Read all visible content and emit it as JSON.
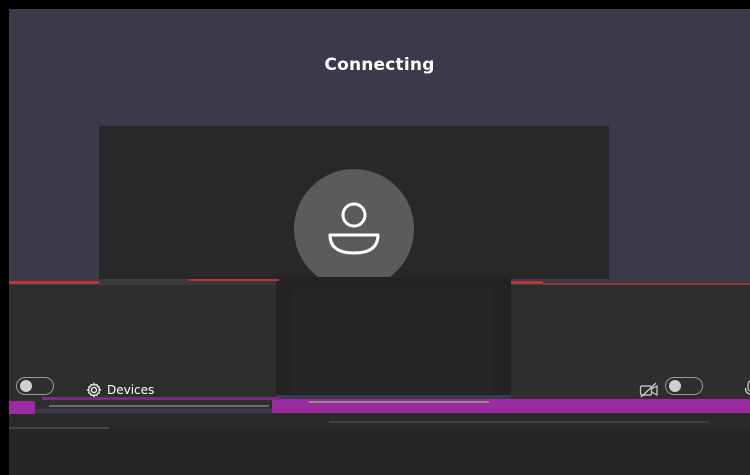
{
  "dialog": {
    "status_title": "Connecting"
  },
  "controls": {
    "devices_label": "Devices",
    "video_toggle_on": false,
    "audio_toggle_on": false
  },
  "icons": {
    "avatar": "person-icon",
    "devices": "gear-icon",
    "camera": "camera-off-icon",
    "microphone": "microphone-icon"
  },
  "colors": {
    "app_background": "#3b3a4a",
    "preview_background": "#282828",
    "avatar_background": "#5b5b5b",
    "glitch_red": "#c0333d",
    "glitch_magenta": "#9b2b9f"
  }
}
